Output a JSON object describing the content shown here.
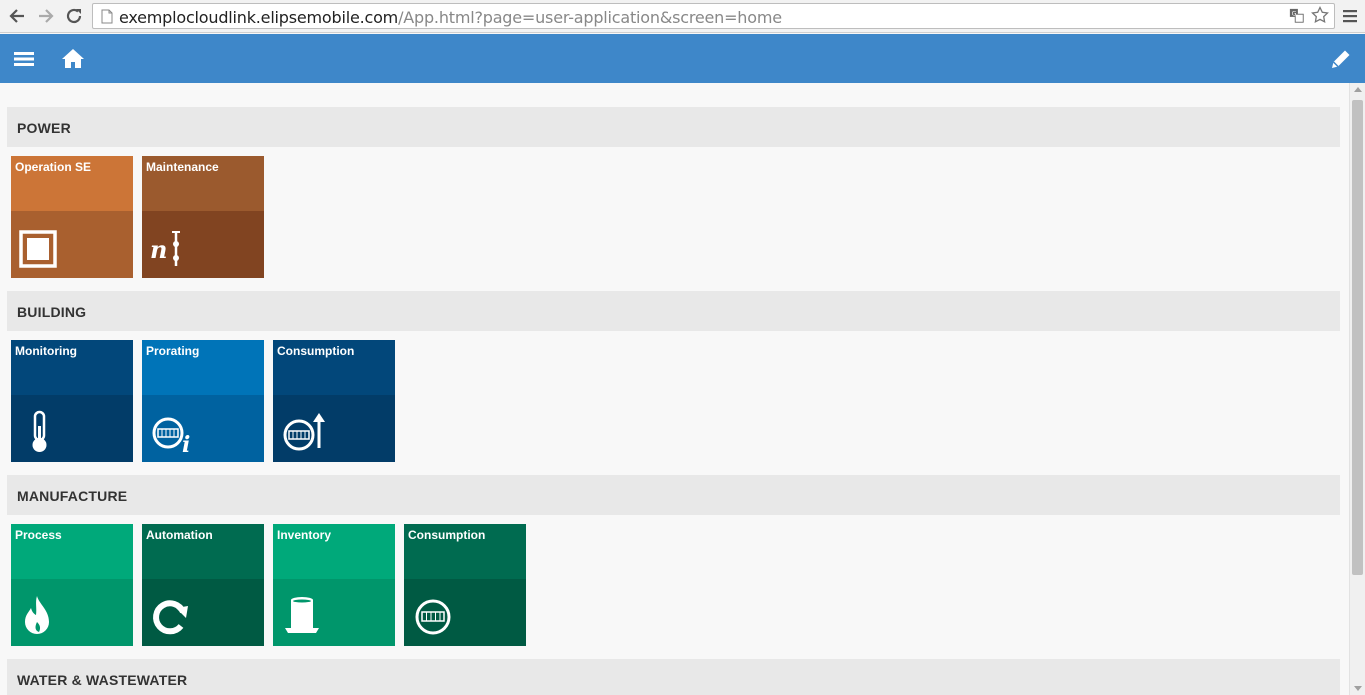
{
  "browser": {
    "url_host": "exemplocloudlink.elipsemobile.com",
    "url_path": "/App.html?page=user-application&screen=home",
    "back_icon": "back-arrow-icon",
    "forward_icon": "forward-arrow-icon",
    "reload_icon": "reload-icon",
    "translate_icon": "translate-icon",
    "bookmark_icon": "star-icon",
    "menu_icon": "hamburger-icon"
  },
  "header": {
    "background": "#3e87c9",
    "menu_icon": "hamburger-icon",
    "home_icon": "home-icon",
    "edit_icon": "pencil-icon"
  },
  "sections": [
    {
      "title": "POWER",
      "tiles": [
        {
          "label": "Operation SE",
          "icon": "substation-icon",
          "top_color": "#cc7537",
          "bottom_color": "#a9602f"
        },
        {
          "label": "Maintenance",
          "icon": "maintenance-icon",
          "top_color": "#9b5a2e",
          "bottom_color": "#814421"
        }
      ]
    },
    {
      "title": "BUILDING",
      "tiles": [
        {
          "label": "Monitoring",
          "icon": "thermometer-icon",
          "top_color": "#02477a",
          "bottom_color": "#023c68"
        },
        {
          "label": "Prorating",
          "icon": "meter-info-icon",
          "top_color": "#0074b8",
          "bottom_color": "#0062a0"
        },
        {
          "label": "Consumption",
          "icon": "meter-up-icon",
          "top_color": "#02477a",
          "bottom_color": "#023c68"
        }
      ]
    },
    {
      "title": "MANUFACTURE",
      "tiles": [
        {
          "label": "Process",
          "icon": "flame-icon",
          "top_color": "#00a97a",
          "bottom_color": "#00966b"
        },
        {
          "label": "Automation",
          "icon": "refresh-icon",
          "top_color": "#006b50",
          "bottom_color": "#005a43"
        },
        {
          "label": "Inventory",
          "icon": "tank-icon",
          "top_color": "#00a97a",
          "bottom_color": "#00966b"
        },
        {
          "label": "Consumption",
          "icon": "meter-icon",
          "top_color": "#006b50",
          "bottom_color": "#005a43"
        }
      ]
    },
    {
      "title": "WATER & WASTEWATER",
      "tiles": []
    }
  ]
}
